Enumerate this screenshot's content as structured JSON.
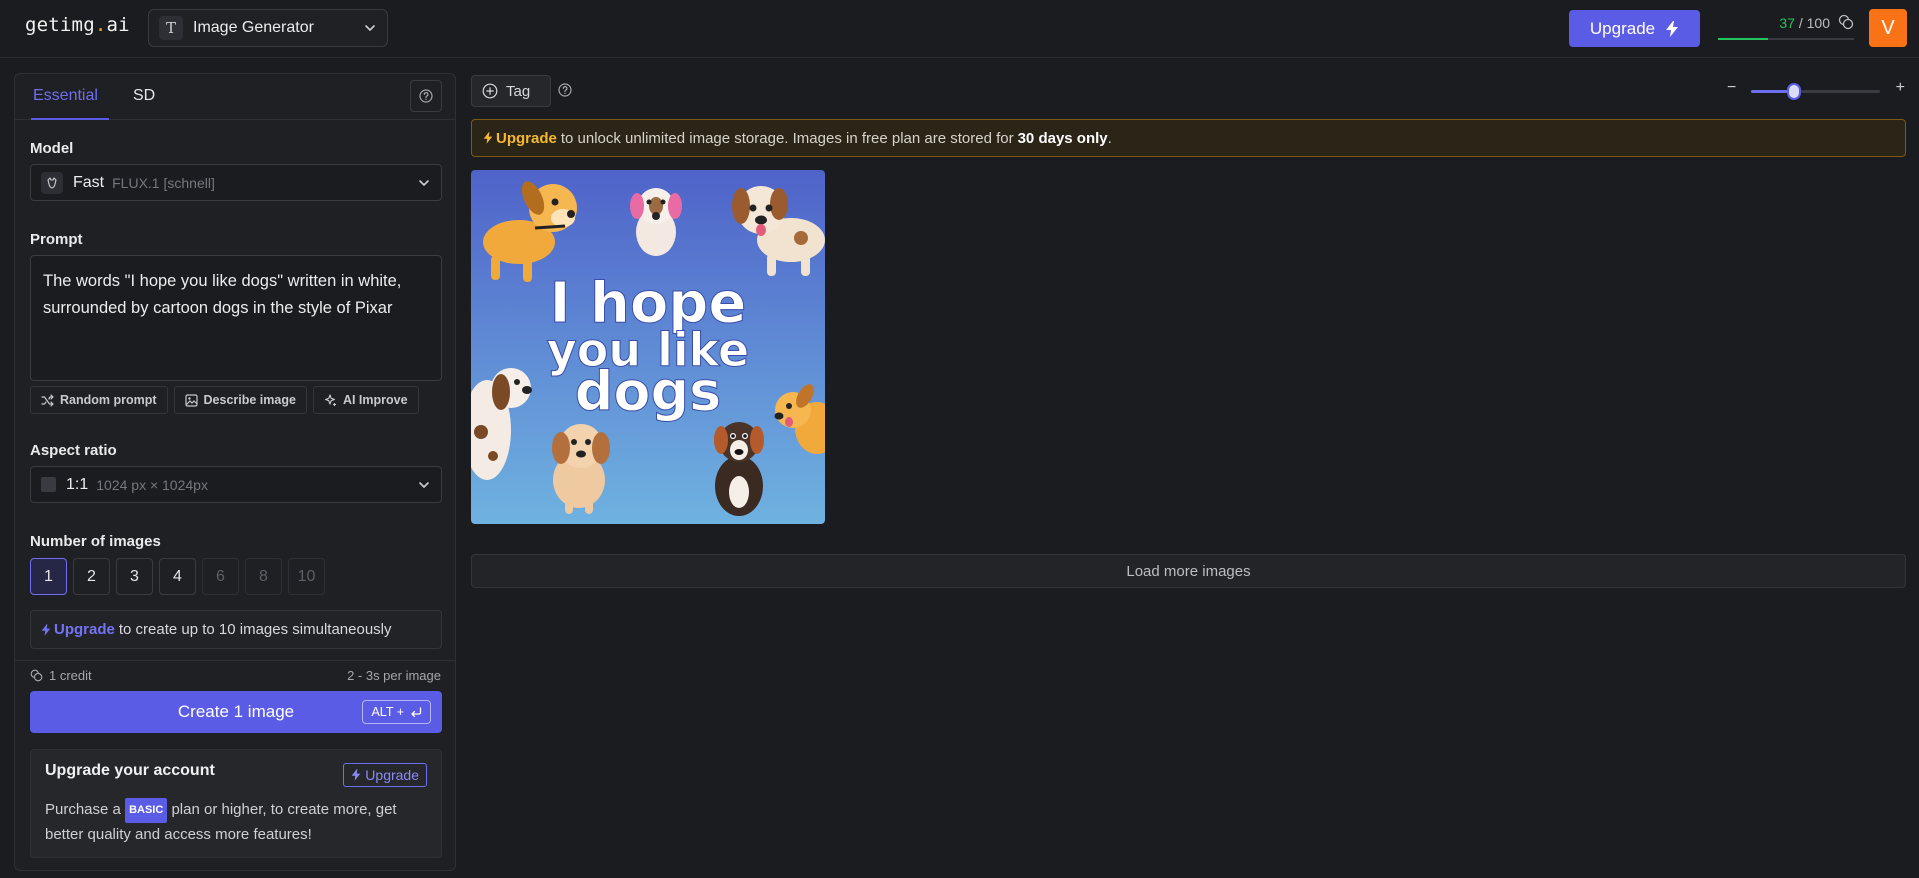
{
  "header": {
    "logo_main": "getimg",
    "logo_dot": ".",
    "logo_tld": "ai",
    "tool_icon_letter": "T",
    "tool_label": "Image Generator",
    "upgrade_label": "Upgrade",
    "credits_used": "37",
    "credits_total": " / 100",
    "credits_fraction": 0.37,
    "avatar_letter": "V"
  },
  "panel": {
    "tabs": [
      {
        "label": "Essential",
        "active": true
      },
      {
        "label": "SD",
        "active": false
      }
    ],
    "model": {
      "label": "Model",
      "name": "Fast",
      "sub": "FLUX.1 [schnell]"
    },
    "prompt": {
      "label": "Prompt",
      "value": "The words \"I hope you like dogs\" written in white, surrounded by cartoon dogs in the style of Pixar"
    },
    "prompt_tools": [
      {
        "label": "Random prompt",
        "icon": "shuffle-icon"
      },
      {
        "label": "Describe image",
        "icon": "image-icon"
      },
      {
        "label": "AI Improve",
        "icon": "sparkle-icon"
      }
    ],
    "aspect": {
      "label": "Aspect ratio",
      "ratio": "1:1",
      "size": "1024 px × 1024px"
    },
    "num_images": {
      "label": "Number of images",
      "options": [
        "1",
        "2",
        "3",
        "4",
        "6",
        "8",
        "10"
      ],
      "selected": "1"
    },
    "upsell": {
      "link": "Upgrade",
      "text": "to create up to 10 images simultaneously"
    },
    "cost": "1 credit",
    "per_image": "2 - 3s per image",
    "create_label": "Create 1 image",
    "shortcut": "ALT +",
    "account": {
      "title": "Upgrade your account",
      "button": "Upgrade",
      "desc_before": "Purchase a",
      "badge": "BASIC",
      "desc_after": "plan or higher, to create more, get better quality and access more features!"
    }
  },
  "main": {
    "tag_label": "Tag",
    "zoom_level": 0.33,
    "banner": {
      "link": "Upgrade",
      "text": "to unlock unlimited image storage. Images in free plan are stored for",
      "bold": "30 days only",
      "end": "."
    },
    "image": {
      "line1": "I hope",
      "line2": "you like",
      "line3": "dogs"
    },
    "load_more": "Load more images"
  },
  "colors": {
    "accent": "#5b5ce6",
    "avatar": "#f97316",
    "credits": "#22c55e",
    "banner_link": "#f5b82e"
  }
}
